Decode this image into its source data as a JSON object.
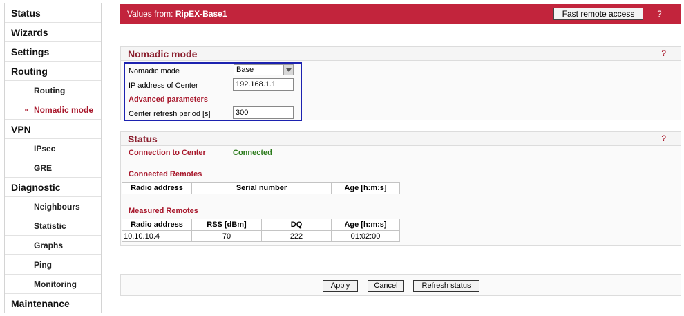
{
  "sidebar": {
    "items": [
      {
        "label": "Status",
        "level": "top"
      },
      {
        "label": "Wizards",
        "level": "top"
      },
      {
        "label": "Settings",
        "level": "top"
      },
      {
        "label": "Routing",
        "level": "top"
      },
      {
        "label": "Routing",
        "level": "sub"
      },
      {
        "label": "Nomadic mode",
        "level": "sub",
        "active": true
      },
      {
        "label": "VPN",
        "level": "top"
      },
      {
        "label": "IPsec",
        "level": "sub"
      },
      {
        "label": "GRE",
        "level": "sub"
      },
      {
        "label": "Diagnostic",
        "level": "top"
      },
      {
        "label": "Neighbours",
        "level": "sub"
      },
      {
        "label": "Statistic",
        "level": "sub"
      },
      {
        "label": "Graphs",
        "level": "sub"
      },
      {
        "label": "Ping",
        "level": "sub"
      },
      {
        "label": "Monitoring",
        "level": "sub"
      },
      {
        "label": "Maintenance",
        "level": "top"
      }
    ],
    "active_marker": "»"
  },
  "header": {
    "prefix": "Values from: ",
    "device": "RipEX-Base1",
    "fast_remote_label": "Fast remote access",
    "help": "?"
  },
  "nomadic": {
    "title": "Nomadic mode",
    "help": "?",
    "mode_label": "Nomadic mode",
    "mode_value": "Base",
    "ip_label": "IP address of Center",
    "ip_value": "192.168.1.1",
    "advanced_label": "Advanced parameters",
    "refresh_label": "Center refresh period [s]",
    "refresh_value": "300"
  },
  "status": {
    "title": "Status",
    "help": "?",
    "connection_label": "Connection to Center",
    "connection_value": "Connected",
    "connected_remotes_label": "Connected Remotes",
    "connected_headers": [
      "Radio address",
      "Serial number",
      "Age [h:m:s]"
    ],
    "measured_remotes_label": "Measured Remotes",
    "measured_headers": [
      "Radio address",
      "RSS [dBm]",
      "DQ",
      "Age [h:m:s]"
    ],
    "measured_rows": [
      [
        "10.10.10.4",
        "70",
        "222",
        "01:02:00"
      ]
    ]
  },
  "buttons": {
    "apply": "Apply",
    "cancel": "Cancel",
    "refresh": "Refresh status"
  },
  "colors": {
    "header_bg": "#c2243c",
    "title_red": "#8b1f2e",
    "label_red": "#a8182c",
    "connected_green": "#2a7a1a",
    "highlight_blue": "#1c22b0"
  }
}
